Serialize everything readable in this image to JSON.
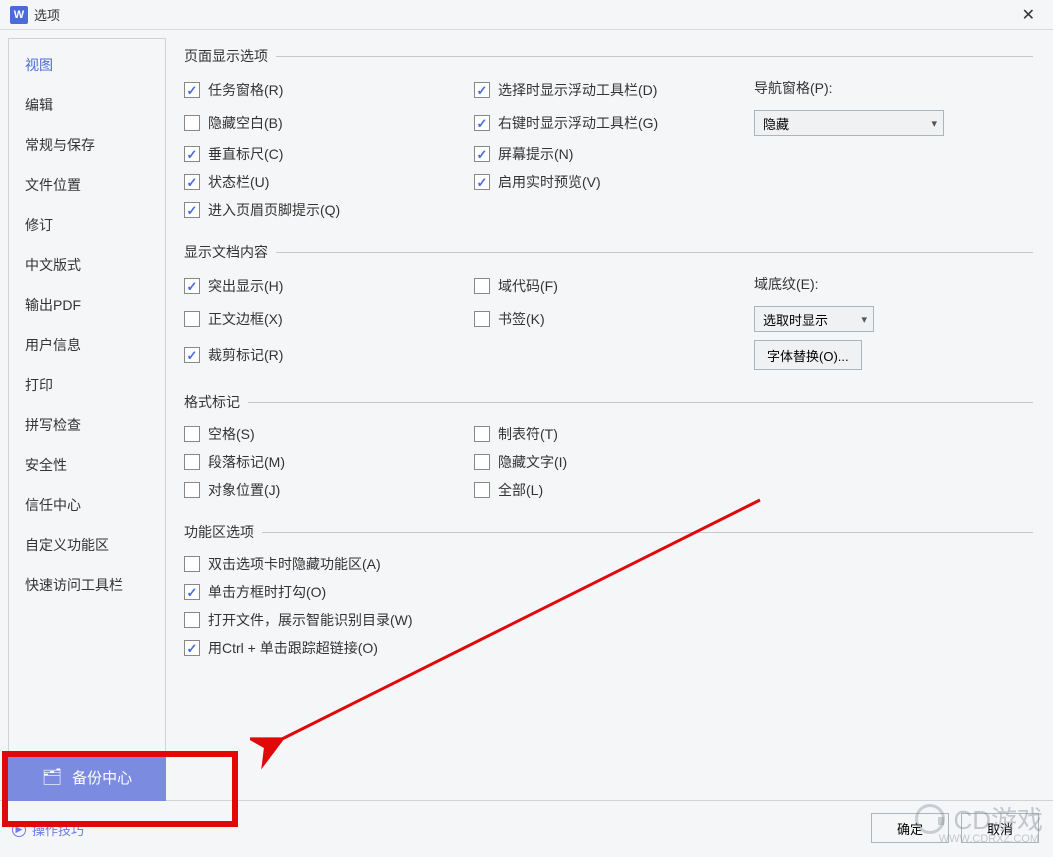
{
  "app_icon_letter": "W",
  "title": "选项",
  "sidebar": {
    "items": [
      {
        "label": "视图",
        "active": true
      },
      {
        "label": "编辑"
      },
      {
        "label": "常规与保存"
      },
      {
        "label": "文件位置"
      },
      {
        "label": "修订"
      },
      {
        "label": "中文版式"
      },
      {
        "label": "输出PDF"
      },
      {
        "label": "用户信息"
      },
      {
        "label": "打印"
      },
      {
        "label": "拼写检查"
      },
      {
        "label": "安全性"
      },
      {
        "label": "信任中心"
      },
      {
        "label": "自定义功能区"
      },
      {
        "label": "快速访问工具栏"
      }
    ]
  },
  "sections": {
    "page_display": {
      "legend": "页面显示选项",
      "task_pane": {
        "label": "任务窗格(R)",
        "checked": true
      },
      "hide_blank": {
        "label": "隐藏空白(B)",
        "checked": false
      },
      "vruler": {
        "label": "垂直标尺(C)",
        "checked": true
      },
      "statusbar": {
        "label": "状态栏(U)",
        "checked": true
      },
      "header_footer_tip": {
        "label": "进入页眉页脚提示(Q)",
        "checked": true
      },
      "float_sel": {
        "label": "选择时显示浮动工具栏(D)",
        "checked": true
      },
      "float_rclick": {
        "label": "右键时显示浮动工具栏(G)",
        "checked": true
      },
      "screen_tip": {
        "label": "屏幕提示(N)",
        "checked": true
      },
      "live_preview": {
        "label": "启用实时预览(V)",
        "checked": true
      },
      "nav_label": "导航窗格(P):",
      "nav_value": "隐藏"
    },
    "doc_content": {
      "legend": "显示文档内容",
      "highlight": {
        "label": "突出显示(H)",
        "checked": true
      },
      "text_border": {
        "label": "正文边框(X)",
        "checked": false
      },
      "crop_marks": {
        "label": "裁剪标记(R)",
        "checked": true
      },
      "field_code": {
        "label": "域代码(F)",
        "checked": false
      },
      "bookmark": {
        "label": "书签(K)",
        "checked": false
      },
      "shading_label": "域底纹(E):",
      "shading_value": "选取时显示",
      "font_sub_btn": "字体替换(O)..."
    },
    "format_marks": {
      "legend": "格式标记",
      "space": {
        "label": "空格(S)",
        "checked": false
      },
      "para": {
        "label": "段落标记(M)",
        "checked": false
      },
      "obj_pos": {
        "label": "对象位置(J)",
        "checked": false
      },
      "tab": {
        "label": "制表符(T)",
        "checked": false
      },
      "hidden_text": {
        "label": "隐藏文字(I)",
        "checked": false
      },
      "all": {
        "label": "全部(L)",
        "checked": false
      }
    },
    "ribbon": {
      "legend": "功能区选项",
      "dbl_hide": {
        "label": "双击选项卡时隐藏功能区(A)",
        "checked": false
      },
      "click_check": {
        "label": "单击方框时打勾(O)",
        "checked": true
      },
      "smart_toc": {
        "label": "打开文件，展示智能识别目录(W)",
        "checked": false
      },
      "ctrl_link": {
        "label": "用Ctrl + 单击跟踪超链接(O)",
        "checked": true
      }
    }
  },
  "backup_btn": "备份中心",
  "tips_label": "操作技巧",
  "ok_btn": "确定",
  "cancel_btn": "取消",
  "watermark": "CD游戏",
  "watermark_sub": "WWW.CDRXZ.COM"
}
